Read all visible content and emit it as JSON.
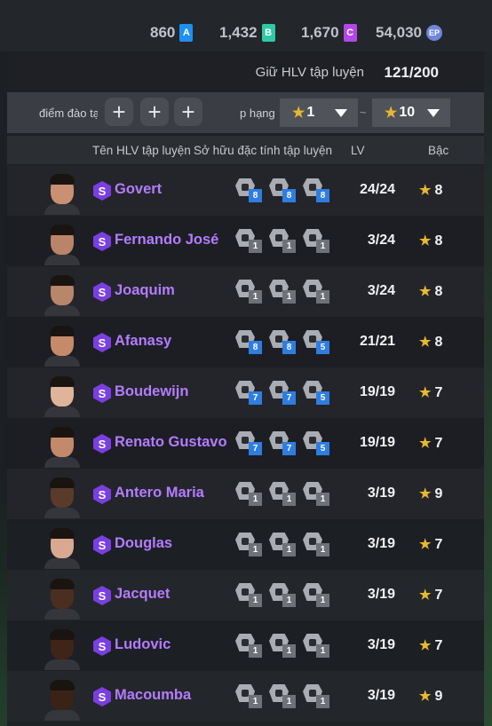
{
  "currencies": [
    {
      "value": "860",
      "icon_label": "A",
      "icon": "currency-a-icon",
      "color": "#1f8ff0"
    },
    {
      "value": "1,432",
      "icon_label": "B",
      "icon": "currency-b-icon",
      "color": "#2fc9a6"
    },
    {
      "value": "1,670",
      "icon_label": "C",
      "icon": "currency-c-icon",
      "color": "#b447e8"
    },
    {
      "value": "54,030",
      "icon_label": "EP",
      "icon": "ep-coin-icon",
      "color": "#6f86d9"
    }
  ],
  "hold": {
    "label": "Giữ HLV tập luyện",
    "value": "121/200"
  },
  "filter": {
    "training_points_label": "điểm đào tạ",
    "rank_label": "p hạng",
    "min_rank": "1",
    "separator": "~",
    "max_rank": "10"
  },
  "headers": {
    "name": "Tên HLV tập luyện",
    "traits": "Sở hữu đặc tính tập luyện",
    "lv": "LV",
    "tier": "Bậc"
  },
  "rows": [
    {
      "name": "Govert",
      "lv": "24/24",
      "tier": "8",
      "skin": "#c99072",
      "traits": [
        {
          "icon": "trait-icon",
          "level": "8",
          "color": "#2f7de0"
        },
        {
          "icon": "trait-icon",
          "level": "8",
          "color": "#2f7de0"
        },
        {
          "icon": "trait-icon",
          "level": "8",
          "color": "#2f7de0"
        }
      ]
    },
    {
      "name": "Fernando José",
      "lv": "3/24",
      "tier": "8",
      "skin": "#b98467",
      "traits": [
        {
          "icon": "trait-icon",
          "level": "1",
          "color": "#6e7178"
        },
        {
          "icon": "trait-icon",
          "level": "1",
          "color": "#6e7178"
        },
        {
          "icon": "trait-icon",
          "level": "1",
          "color": "#6e7178"
        }
      ]
    },
    {
      "name": "Joaquim",
      "lv": "3/24",
      "tier": "8",
      "skin": "#b8866a",
      "traits": [
        {
          "icon": "trait-icon",
          "level": "1",
          "color": "#6e7178"
        },
        {
          "icon": "trait-icon",
          "level": "1",
          "color": "#6e7178"
        },
        {
          "icon": "trait-icon",
          "level": "1",
          "color": "#6e7178"
        }
      ]
    },
    {
      "name": "Afanasy",
      "lv": "21/21",
      "tier": "8",
      "skin": "#c58a6a",
      "traits": [
        {
          "icon": "trait-icon",
          "level": "8",
          "color": "#2f7de0"
        },
        {
          "icon": "trait-icon",
          "level": "8",
          "color": "#2f7de0"
        },
        {
          "icon": "trait-icon",
          "level": "5",
          "color": "#2f7de0"
        }
      ]
    },
    {
      "name": "Boudewijn",
      "lv": "19/19",
      "tier": "7",
      "skin": "#e0b49a",
      "traits": [
        {
          "icon": "trait-icon",
          "level": "7",
          "color": "#2f7de0"
        },
        {
          "icon": "trait-icon",
          "level": "7",
          "color": "#2f7de0"
        },
        {
          "icon": "trait-icon",
          "level": "5",
          "color": "#2f7de0"
        }
      ]
    },
    {
      "name": "Renato Gustavo",
      "lv": "19/19",
      "tier": "7",
      "skin": "#c28a6a",
      "traits": [
        {
          "icon": "trait-icon",
          "level": "7",
          "color": "#2f7de0"
        },
        {
          "icon": "trait-icon",
          "level": "7",
          "color": "#2f7de0"
        },
        {
          "icon": "trait-icon",
          "level": "5",
          "color": "#2f7de0"
        }
      ]
    },
    {
      "name": "Antero Maria",
      "lv": "3/19",
      "tier": "9",
      "skin": "#5a3a2a",
      "traits": [
        {
          "icon": "trait-icon",
          "level": "1",
          "color": "#6e7178"
        },
        {
          "icon": "trait-icon",
          "level": "1",
          "color": "#6e7178"
        },
        {
          "icon": "trait-icon",
          "level": "1",
          "color": "#6e7178"
        }
      ]
    },
    {
      "name": "Douglas",
      "lv": "3/19",
      "tier": "7",
      "skin": "#d8a890",
      "traits": [
        {
          "icon": "trait-icon",
          "level": "1",
          "color": "#6e7178"
        },
        {
          "icon": "trait-icon",
          "level": "1",
          "color": "#6e7178"
        },
        {
          "icon": "trait-icon",
          "level": "1",
          "color": "#6e7178"
        }
      ]
    },
    {
      "name": "Jacquet",
      "lv": "3/19",
      "tier": "7",
      "skin": "#4a2e20",
      "traits": [
        {
          "icon": "trait-icon",
          "level": "1",
          "color": "#6e7178"
        },
        {
          "icon": "trait-icon",
          "level": "1",
          "color": "#6e7178"
        },
        {
          "icon": "trait-icon",
          "level": "1",
          "color": "#6e7178"
        }
      ]
    },
    {
      "name": "Ludovic",
      "lv": "3/19",
      "tier": "7",
      "skin": "#3e2518",
      "traits": [
        {
          "icon": "trait-icon",
          "level": "1",
          "color": "#6e7178"
        },
        {
          "icon": "trait-icon",
          "level": "1",
          "color": "#6e7178"
        },
        {
          "icon": "trait-icon",
          "level": "1",
          "color": "#6e7178"
        }
      ]
    },
    {
      "name": "Macoumba",
      "lv": "3/19",
      "tier": "9",
      "skin": "#3a2216",
      "traits": [
        {
          "icon": "trait-icon",
          "level": "1",
          "color": "#6e7178"
        },
        {
          "icon": "trait-icon",
          "level": "1",
          "color": "#6e7178"
        },
        {
          "icon": "trait-icon",
          "level": "1",
          "color": "#6e7178"
        }
      ]
    }
  ]
}
